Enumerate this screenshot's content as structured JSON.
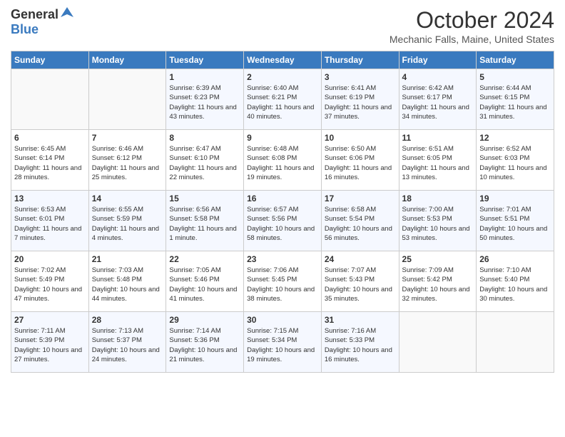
{
  "header": {
    "logo_general": "General",
    "logo_blue": "Blue",
    "month_title": "October 2024",
    "location": "Mechanic Falls, Maine, United States"
  },
  "days_of_week": [
    "Sunday",
    "Monday",
    "Tuesday",
    "Wednesday",
    "Thursday",
    "Friday",
    "Saturday"
  ],
  "weeks": [
    [
      {
        "day": "",
        "content": ""
      },
      {
        "day": "",
        "content": ""
      },
      {
        "day": "1",
        "sunrise": "Sunrise: 6:39 AM",
        "sunset": "Sunset: 6:23 PM",
        "daylight": "Daylight: 11 hours and 43 minutes."
      },
      {
        "day": "2",
        "sunrise": "Sunrise: 6:40 AM",
        "sunset": "Sunset: 6:21 PM",
        "daylight": "Daylight: 11 hours and 40 minutes."
      },
      {
        "day": "3",
        "sunrise": "Sunrise: 6:41 AM",
        "sunset": "Sunset: 6:19 PM",
        "daylight": "Daylight: 11 hours and 37 minutes."
      },
      {
        "day": "4",
        "sunrise": "Sunrise: 6:42 AM",
        "sunset": "Sunset: 6:17 PM",
        "daylight": "Daylight: 11 hours and 34 minutes."
      },
      {
        "day": "5",
        "sunrise": "Sunrise: 6:44 AM",
        "sunset": "Sunset: 6:15 PM",
        "daylight": "Daylight: 11 hours and 31 minutes."
      }
    ],
    [
      {
        "day": "6",
        "sunrise": "Sunrise: 6:45 AM",
        "sunset": "Sunset: 6:14 PM",
        "daylight": "Daylight: 11 hours and 28 minutes."
      },
      {
        "day": "7",
        "sunrise": "Sunrise: 6:46 AM",
        "sunset": "Sunset: 6:12 PM",
        "daylight": "Daylight: 11 hours and 25 minutes."
      },
      {
        "day": "8",
        "sunrise": "Sunrise: 6:47 AM",
        "sunset": "Sunset: 6:10 PM",
        "daylight": "Daylight: 11 hours and 22 minutes."
      },
      {
        "day": "9",
        "sunrise": "Sunrise: 6:48 AM",
        "sunset": "Sunset: 6:08 PM",
        "daylight": "Daylight: 11 hours and 19 minutes."
      },
      {
        "day": "10",
        "sunrise": "Sunrise: 6:50 AM",
        "sunset": "Sunset: 6:06 PM",
        "daylight": "Daylight: 11 hours and 16 minutes."
      },
      {
        "day": "11",
        "sunrise": "Sunrise: 6:51 AM",
        "sunset": "Sunset: 6:05 PM",
        "daylight": "Daylight: 11 hours and 13 minutes."
      },
      {
        "day": "12",
        "sunrise": "Sunrise: 6:52 AM",
        "sunset": "Sunset: 6:03 PM",
        "daylight": "Daylight: 11 hours and 10 minutes."
      }
    ],
    [
      {
        "day": "13",
        "sunrise": "Sunrise: 6:53 AM",
        "sunset": "Sunset: 6:01 PM",
        "daylight": "Daylight: 11 hours and 7 minutes."
      },
      {
        "day": "14",
        "sunrise": "Sunrise: 6:55 AM",
        "sunset": "Sunset: 5:59 PM",
        "daylight": "Daylight: 11 hours and 4 minutes."
      },
      {
        "day": "15",
        "sunrise": "Sunrise: 6:56 AM",
        "sunset": "Sunset: 5:58 PM",
        "daylight": "Daylight: 11 hours and 1 minute."
      },
      {
        "day": "16",
        "sunrise": "Sunrise: 6:57 AM",
        "sunset": "Sunset: 5:56 PM",
        "daylight": "Daylight: 10 hours and 58 minutes."
      },
      {
        "day": "17",
        "sunrise": "Sunrise: 6:58 AM",
        "sunset": "Sunset: 5:54 PM",
        "daylight": "Daylight: 10 hours and 56 minutes."
      },
      {
        "day": "18",
        "sunrise": "Sunrise: 7:00 AM",
        "sunset": "Sunset: 5:53 PM",
        "daylight": "Daylight: 10 hours and 53 minutes."
      },
      {
        "day": "19",
        "sunrise": "Sunrise: 7:01 AM",
        "sunset": "Sunset: 5:51 PM",
        "daylight": "Daylight: 10 hours and 50 minutes."
      }
    ],
    [
      {
        "day": "20",
        "sunrise": "Sunrise: 7:02 AM",
        "sunset": "Sunset: 5:49 PM",
        "daylight": "Daylight: 10 hours and 47 minutes."
      },
      {
        "day": "21",
        "sunrise": "Sunrise: 7:03 AM",
        "sunset": "Sunset: 5:48 PM",
        "daylight": "Daylight: 10 hours and 44 minutes."
      },
      {
        "day": "22",
        "sunrise": "Sunrise: 7:05 AM",
        "sunset": "Sunset: 5:46 PM",
        "daylight": "Daylight: 10 hours and 41 minutes."
      },
      {
        "day": "23",
        "sunrise": "Sunrise: 7:06 AM",
        "sunset": "Sunset: 5:45 PM",
        "daylight": "Daylight: 10 hours and 38 minutes."
      },
      {
        "day": "24",
        "sunrise": "Sunrise: 7:07 AM",
        "sunset": "Sunset: 5:43 PM",
        "daylight": "Daylight: 10 hours and 35 minutes."
      },
      {
        "day": "25",
        "sunrise": "Sunrise: 7:09 AM",
        "sunset": "Sunset: 5:42 PM",
        "daylight": "Daylight: 10 hours and 32 minutes."
      },
      {
        "day": "26",
        "sunrise": "Sunrise: 7:10 AM",
        "sunset": "Sunset: 5:40 PM",
        "daylight": "Daylight: 10 hours and 30 minutes."
      }
    ],
    [
      {
        "day": "27",
        "sunrise": "Sunrise: 7:11 AM",
        "sunset": "Sunset: 5:39 PM",
        "daylight": "Daylight: 10 hours and 27 minutes."
      },
      {
        "day": "28",
        "sunrise": "Sunrise: 7:13 AM",
        "sunset": "Sunset: 5:37 PM",
        "daylight": "Daylight: 10 hours and 24 minutes."
      },
      {
        "day": "29",
        "sunrise": "Sunrise: 7:14 AM",
        "sunset": "Sunset: 5:36 PM",
        "daylight": "Daylight: 10 hours and 21 minutes."
      },
      {
        "day": "30",
        "sunrise": "Sunrise: 7:15 AM",
        "sunset": "Sunset: 5:34 PM",
        "daylight": "Daylight: 10 hours and 19 minutes."
      },
      {
        "day": "31",
        "sunrise": "Sunrise: 7:16 AM",
        "sunset": "Sunset: 5:33 PM",
        "daylight": "Daylight: 10 hours and 16 minutes."
      },
      {
        "day": "",
        "content": ""
      },
      {
        "day": "",
        "content": ""
      }
    ]
  ]
}
